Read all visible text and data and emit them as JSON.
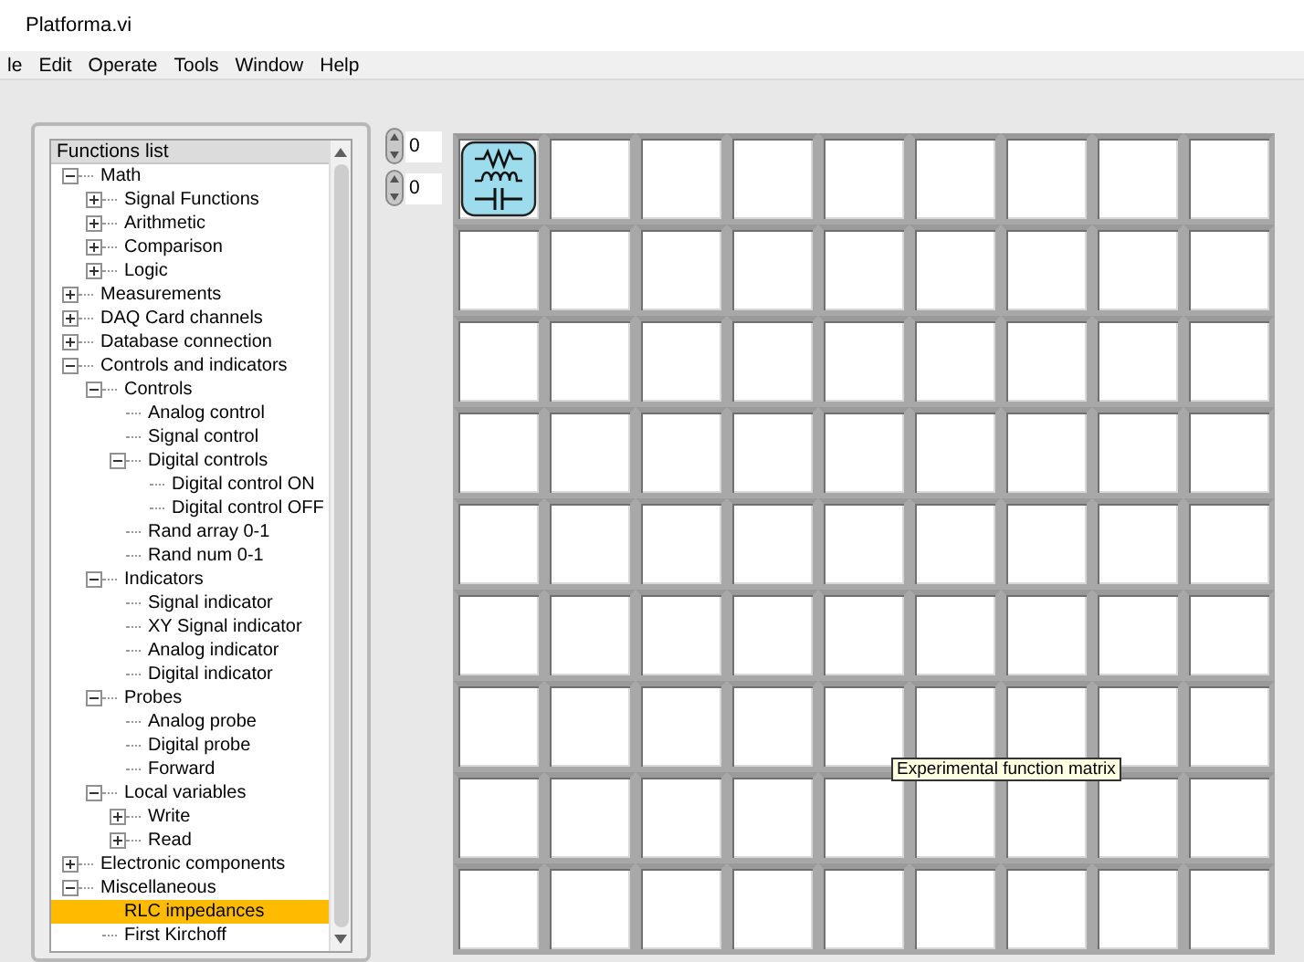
{
  "window": {
    "title": "Platforma.vi"
  },
  "menu": [
    "le",
    "Edit",
    "Operate",
    "Tools",
    "Window",
    "Help"
  ],
  "tree": {
    "heading": "Functions list",
    "items": [
      {
        "label": "Math",
        "expanded": true,
        "selected": false,
        "children": [
          {
            "label": "Signal Functions",
            "expanded": false,
            "selected": false
          },
          {
            "label": "Arithmetic",
            "expanded": false,
            "selected": false
          },
          {
            "label": "Comparison",
            "expanded": false,
            "selected": false
          },
          {
            "label": "Logic",
            "expanded": false,
            "selected": false
          }
        ]
      },
      {
        "label": "Measurements",
        "expanded": false,
        "selected": false
      },
      {
        "label": "DAQ Card channels",
        "expanded": false,
        "selected": false
      },
      {
        "label": "Database connection",
        "expanded": false,
        "selected": false
      },
      {
        "label": "Controls and indicators",
        "expanded": true,
        "selected": false,
        "children": [
          {
            "label": "Controls",
            "expanded": true,
            "selected": false,
            "children": [
              {
                "label": "Analog control",
                "selected": false
              },
              {
                "label": "Signal control",
                "selected": false
              },
              {
                "label": "Digital controls",
                "expanded": true,
                "selected": false,
                "children": [
                  {
                    "label": "Digital control ON",
                    "selected": false
                  },
                  {
                    "label": "Digital control OFF",
                    "selected": false
                  }
                ]
              },
              {
                "label": "Rand array 0-1",
                "selected": false
              },
              {
                "label": "Rand num 0-1",
                "selected": false
              }
            ]
          },
          {
            "label": "Indicators",
            "expanded": true,
            "selected": false,
            "children": [
              {
                "label": "Signal indicator",
                "selected": false
              },
              {
                "label": "XY Signal indicator",
                "selected": false
              },
              {
                "label": "Analog indicator",
                "selected": false
              },
              {
                "label": "Digital indicator",
                "selected": false
              }
            ]
          },
          {
            "label": "Probes",
            "expanded": true,
            "selected": false,
            "children": [
              {
                "label": "Analog probe",
                "selected": false
              },
              {
                "label": "Digital probe",
                "selected": false
              },
              {
                "label": "Forward",
                "selected": false
              }
            ]
          },
          {
            "label": "Local variables",
            "expanded": true,
            "selected": false,
            "children": [
              {
                "label": "Write",
                "expanded": false,
                "selected": false
              },
              {
                "label": "Read",
                "expanded": false,
                "selected": false
              }
            ]
          }
        ]
      },
      {
        "label": "Electronic components",
        "expanded": false,
        "selected": false
      },
      {
        "label": "Miscellaneous",
        "expanded": true,
        "selected": false,
        "children": [
          {
            "label": "RLC impedances",
            "selected": true
          },
          {
            "label": "First Kirchoff",
            "selected": false
          }
        ]
      }
    ]
  },
  "spinners": [
    {
      "value": "0"
    },
    {
      "value": "0"
    }
  ],
  "matrix": {
    "tooltip": "Experimental function matrix",
    "rows": [
      [
        {
          "kind": "rlc"
        },
        {
          "kind": "empty"
        },
        {
          "kind": "empty"
        },
        {
          "kind": "empty"
        },
        {
          "kind": "empty"
        },
        {
          "kind": "empty"
        },
        {
          "kind": "empty"
        },
        {
          "kind": "empty"
        },
        {
          "kind": "empty"
        }
      ],
      [
        {
          "kind": "empty"
        },
        {
          "kind": "empty"
        },
        {
          "kind": "empty"
        },
        {
          "kind": "empty"
        },
        {
          "kind": "empty"
        },
        {
          "kind": "empty"
        },
        {
          "kind": "empty"
        },
        {
          "kind": "empty"
        },
        {
          "kind": "empty"
        }
      ],
      [
        {
          "kind": "empty"
        },
        {
          "kind": "empty"
        },
        {
          "kind": "empty"
        },
        {
          "kind": "empty"
        },
        {
          "kind": "empty"
        },
        {
          "kind": "empty"
        },
        {
          "kind": "empty"
        },
        {
          "kind": "empty"
        },
        {
          "kind": "empty"
        }
      ],
      [
        {
          "kind": "empty"
        },
        {
          "kind": "empty"
        },
        {
          "kind": "empty"
        },
        {
          "kind": "empty"
        },
        {
          "kind": "empty"
        },
        {
          "kind": "empty"
        },
        {
          "kind": "empty"
        },
        {
          "kind": "empty"
        },
        {
          "kind": "empty"
        }
      ],
      [
        {
          "kind": "empty"
        },
        {
          "kind": "empty"
        },
        {
          "kind": "empty"
        },
        {
          "kind": "empty"
        },
        {
          "kind": "empty"
        },
        {
          "kind": "empty"
        },
        {
          "kind": "empty"
        },
        {
          "kind": "empty"
        },
        {
          "kind": "empty"
        }
      ],
      [
        {
          "kind": "empty"
        },
        {
          "kind": "empty"
        },
        {
          "kind": "empty"
        },
        {
          "kind": "empty"
        },
        {
          "kind": "empty"
        },
        {
          "kind": "empty"
        },
        {
          "kind": "empty"
        },
        {
          "kind": "empty"
        },
        {
          "kind": "empty"
        }
      ],
      [
        {
          "kind": "empty"
        },
        {
          "kind": "empty"
        },
        {
          "kind": "empty"
        },
        {
          "kind": "empty"
        },
        {
          "kind": "empty"
        },
        {
          "kind": "empty"
        },
        {
          "kind": "empty"
        },
        {
          "kind": "empty"
        },
        {
          "kind": "empty"
        }
      ],
      [
        {
          "kind": "empty"
        },
        {
          "kind": "empty"
        },
        {
          "kind": "empty"
        },
        {
          "kind": "empty"
        },
        {
          "kind": "empty"
        },
        {
          "kind": "empty"
        },
        {
          "kind": "empty"
        },
        {
          "kind": "empty"
        },
        {
          "kind": "empty"
        }
      ],
      [
        {
          "kind": "empty"
        },
        {
          "kind": "empty"
        },
        {
          "kind": "empty"
        },
        {
          "kind": "empty"
        },
        {
          "kind": "empty"
        },
        {
          "kind": "empty"
        },
        {
          "kind": "empty"
        },
        {
          "kind": "empty"
        },
        {
          "kind": "empty"
        }
      ]
    ]
  }
}
